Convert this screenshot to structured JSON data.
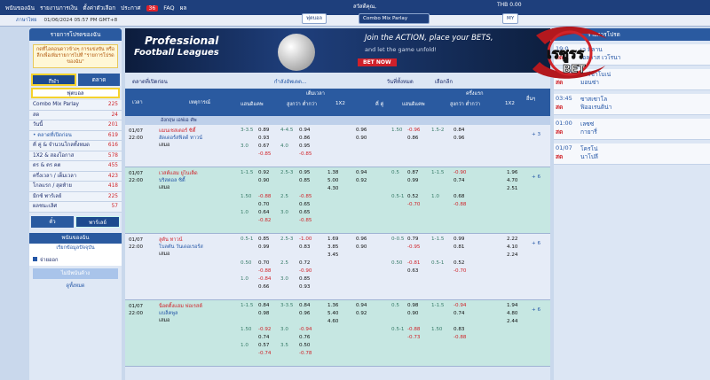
{
  "header": {
    "nav": [
      "พนันของฉัน",
      "รายงานการเงิน",
      "ตั้งค่าตัวเลือก",
      "ประกาศ",
      "FAQ",
      "ผล"
    ],
    "announce_count": "36",
    "language": "ภาษาไทย",
    "datetime": "01/06/2024 05:57 PM GMT+8",
    "sport_btn": "ฟุตบอล",
    "combo_btn": "Combo Mix Parlay",
    "user_greeting": "สวัสดีคุณ,",
    "balance": "THB 0.00",
    "my_btn": "MY"
  },
  "left": {
    "header": "รายการโปรดของฉัน",
    "note": "กดที่ไอคอนดาวข้างๆ การแข่งขัน หรือลีกเพื่อเพิ่มรายการไปที่ \"รายการโปรดของฉัน\"",
    "tabs": [
      "กีฬา",
      "ตลาด"
    ],
    "selected_sport": "ฟุตบอล",
    "menu": [
      {
        "label": "Combo Mix Parlay",
        "n": "225"
      },
      {
        "label": "สด",
        "n": "24"
      },
      {
        "label": "วันนี้",
        "n": "201"
      },
      {
        "label": "• ตลาดที่เปิดก่อน",
        "n": "619"
      },
      {
        "label": "คี่ คู่ & จำนวนโกลทั้งหมด",
        "n": "616"
      },
      {
        "label": "1X2 & สองโอกาส",
        "n": "578"
      },
      {
        "label": "ตร & ตร คต",
        "n": "455"
      },
      {
        "label": "ครึ่งเวลา / เต็มเวลา",
        "n": "423"
      },
      {
        "label": "โกลแรก / สุดท้าย",
        "n": "418"
      },
      {
        "label": "มิกซ์ พาร์เลย์",
        "n": "225"
      },
      {
        "label": "ผลชนะเลิศ",
        "n": "57"
      }
    ],
    "tabs2": [
      "ตั๋ว",
      "พาร์เลย์"
    ],
    "mybets_header": "พนันของฉัน",
    "mybets_link": "เรียกข้อมูลปัจจุบัน",
    "accept_label": "จ่ายออก",
    "accept_button": "ไม่มีพนันค้าง",
    "view_all": "ดูทั้งหมด"
  },
  "banner": {
    "line1": "Professional",
    "line2": "Football Leagues",
    "line3": "Join the ACTION, place your BETS,",
    "line4": "and let the game unfold!",
    "cta": "BET NOW"
  },
  "toolbar": {
    "market": "ตลาดที่เปิดก่อน",
    "refresh": "กำลังอัพเดต...",
    "sort": "วันที่ทั้งหมด",
    "select": "เลือกลีก"
  },
  "table_head": {
    "time": "เวลา",
    "event": "เหตุการณ์",
    "fulltime": "เต็มเวลา",
    "halftime": "ครึ่งแรก",
    "hdp": "แฮนดิแคพ",
    "ou": "สูงกว่า ต่ำกว่า",
    "x12": "1X2",
    "oe": "คี่ คู่",
    "more": "อื่นๆ"
  },
  "league": "อังกฤษ เอฟเอ คัพ",
  "matches": [
    {
      "date": "01/07",
      "time": "22:00",
      "home": "แมนเชสเตอร์ ซิตี้",
      "away": "ฮัดเดอร์สฟิลด์ ทาวน์",
      "draw": "เสมอ",
      "more": "+ 3",
      "rows": [
        [
          "3-3.5",
          "0.89",
          "4-4.5",
          "0.94",
          "",
          "0.96",
          "1.50",
          "-0.96",
          "1.5-2",
          "0.84"
        ],
        [
          "",
          "0.93",
          "",
          "0.86",
          "",
          "0.90",
          "",
          "0.86",
          "",
          "0.96"
        ],
        [
          "3.0",
          "0.67",
          "4.0",
          "0.95",
          "",
          "",
          "",
          "",
          "",
          ""
        ],
        [
          "",
          "-0.85",
          "",
          "-0.85",
          "",
          "",
          "",
          "",
          "",
          ""
        ]
      ]
    },
    {
      "date": "01/07",
      "time": "22:00",
      "home": "เวสต์แฮม ยูไนเต็ด",
      "away": "บริสตอล ซิตี้",
      "draw": "เสมอ",
      "more": "+ 6",
      "rows": [
        [
          "1-1.5",
          "0.92",
          "2.5-3",
          "0.95",
          "1.38",
          "0.94",
          "0.5",
          "0.87",
          "1-1.5",
          "-0.90",
          "1.96"
        ],
        [
          "",
          "0.90",
          "",
          "0.85",
          "5.00",
          "0.92",
          "",
          "0.99",
          "",
          "0.74",
          "4.70"
        ],
        [
          "",
          "",
          "",
          "",
          "4.30",
          "",
          "",
          "",
          "",
          "",
          "2.51"
        ],
        [
          "1.50",
          "-0.88",
          "2.5",
          "-0.85",
          "",
          "",
          "0.5-1",
          "0.52",
          "1.0",
          "0.68",
          ""
        ],
        [
          "",
          "0.70",
          "",
          "0.65",
          "",
          "",
          "",
          "-0.70",
          "",
          "-0.88",
          ""
        ],
        [
          "1.0",
          "0.64",
          "3.0",
          "0.65",
          "",
          "",
          "",
          "",
          "",
          "",
          ""
        ],
        [
          "",
          "-0.82",
          "",
          "-0.85",
          "",
          "",
          "",
          "",
          "",
          "",
          ""
        ]
      ]
    },
    {
      "date": "01/07",
      "time": "22:00",
      "home": "ลูตัน ทาวน์",
      "away": "โบลตัน วันเดอเรอร์ส",
      "draw": "เสมอ",
      "more": "+ 6",
      "rows": [
        [
          "0.5-1",
          "0.85",
          "2.5-3",
          "-1.00",
          "1.69",
          "0.96",
          "0-0.5",
          "0.79",
          "1-1.5",
          "0.99",
          "2.22"
        ],
        [
          "",
          "0.99",
          "",
          "0.83",
          "3.85",
          "0.90",
          "",
          "-0.95",
          "",
          "0.81",
          "4.10"
        ],
        [
          "",
          "",
          "",
          "",
          "3.45",
          "",
          "",
          "",
          "",
          "",
          "2.24"
        ],
        [
          "0.50",
          "0.70",
          "2.5",
          "0.72",
          "",
          "",
          "0.50",
          "-0.81",
          "0.5-1",
          "0.52",
          ""
        ],
        [
          "",
          "-0.88",
          "",
          "-0.90",
          "",
          "",
          "",
          "0.63",
          "",
          "-0.70",
          ""
        ],
        [
          "1.0",
          "-0.84",
          "3.0",
          "0.85",
          "",
          "",
          "",
          "",
          "",
          "",
          ""
        ],
        [
          "",
          "0.66",
          "",
          "0.93",
          "",
          "",
          "",
          "",
          "",
          "",
          ""
        ]
      ]
    },
    {
      "date": "01/07",
      "time": "22:00",
      "home": "น็อตติ้งแฮม ฟอเรสต์",
      "away": "แบล็คพูล",
      "draw": "เสมอ",
      "more": "+ 6",
      "rows": [
        [
          "1-1.5",
          "0.84",
          "3-3.5",
          "0.84",
          "1.36",
          "0.94",
          "0.5",
          "0.98",
          "1-1.5",
          "-0.94",
          "1.94"
        ],
        [
          "",
          "0.98",
          "",
          "0.96",
          "5.40",
          "0.92",
          "",
          "0.90",
          "",
          "0.74",
          "4.80"
        ],
        [
          "",
          "",
          "",
          "",
          "4.60",
          "",
          "",
          "",
          "",
          "",
          "2.44"
        ],
        [
          "1.50",
          "-0.92",
          "3.0",
          "-0.94",
          "",
          "",
          "0.5-1",
          "-0.88",
          "1.50",
          "0.83",
          ""
        ],
        [
          "",
          "0.74",
          "",
          "0.76",
          "",
          "",
          "",
          "-0.73",
          "",
          "-0.88",
          ""
        ],
        [
          "1.0",
          "0.57",
          "3.5",
          "0.50",
          "",
          "",
          "",
          "",
          "",
          "",
          ""
        ],
        [
          "",
          "-0.74",
          "",
          "-0.78",
          "",
          "",
          "",
          "",
          "",
          "",
          ""
        ]
      ]
    }
  ],
  "right": {
    "header": "รายการโปรด",
    "items": [
      {
        "t": "19:0",
        "l": "สด",
        "a": "",
        "b": "เอลลาส เวโรนา",
        "top": "เว มีลาน"
      },
      {
        "t": "22:00",
        "l": "สด",
        "a": "ไฟร์ซาโบเน่",
        "b": "มอนซ่า",
        "top": ""
      },
      {
        "t": "03:45",
        "l": "สด",
        "a": "ซาสเซาโล",
        "b": "ฟิออเรนติน่า",
        "top": ""
      },
      {
        "t": "01:00",
        "l": "สด",
        "a": "เลซซ่",
        "b": "กายารี่",
        "top": ""
      },
      {
        "t": "01/07",
        "l": "สด",
        "a": "โครโน่",
        "b": "นาโปลี",
        "top": ""
      }
    ]
  },
  "brand": {
    "name": "BET"
  }
}
